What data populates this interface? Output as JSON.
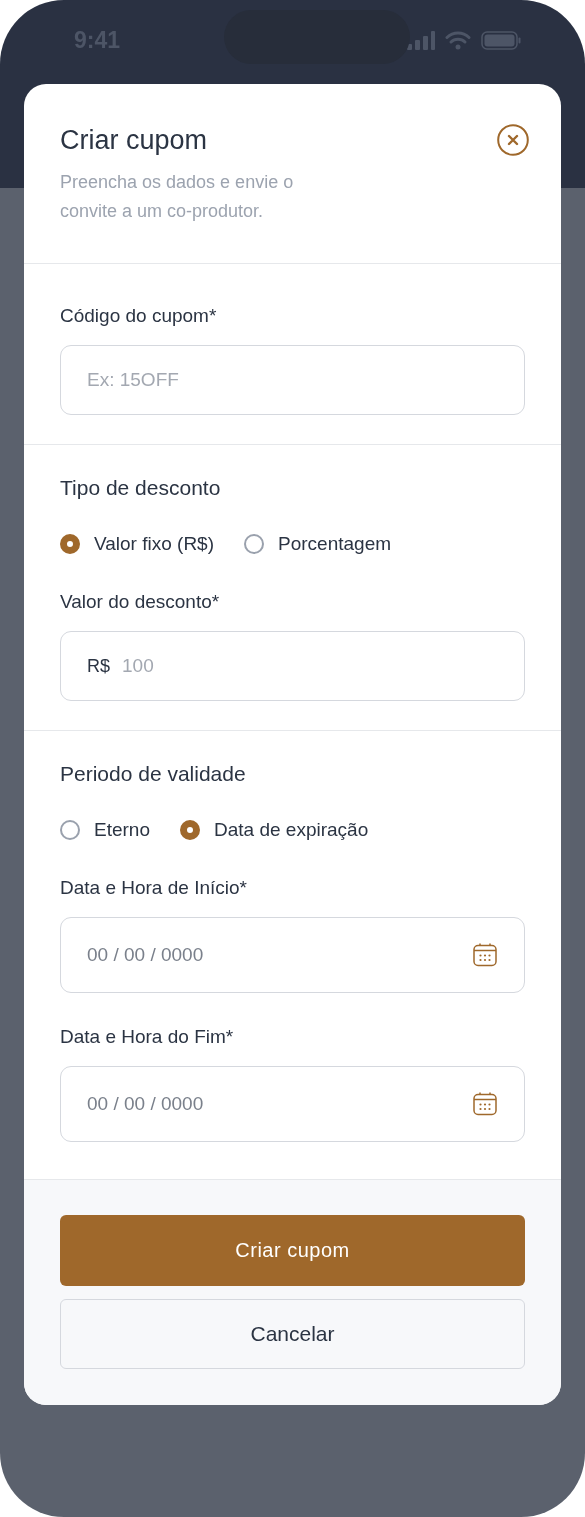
{
  "status_bar": {
    "time": "9:41"
  },
  "modal": {
    "title": "Criar cupom",
    "subtitle": "Preencha os dados e envie o convite a um co-produtor."
  },
  "sections": [
    {
      "fields": [
        {
          "kind": "text",
          "label": "Código do cupom*",
          "placeholder": "Ex: 15OFF"
        }
      ]
    },
    {
      "title": "Tipo de desconto",
      "options": [
        {
          "label": "Valor fixo (R$)",
          "selected": true
        },
        {
          "label": "Porcentagem",
          "selected": false
        }
      ],
      "fields": [
        {
          "kind": "currency",
          "label": "Valor do desconto*",
          "prefix": "R$",
          "placeholder": "100"
        }
      ]
    },
    {
      "title": "Periodo de validade",
      "options": [
        {
          "label": "Eterno",
          "selected": false
        },
        {
          "label": "Data de expiração",
          "selected": true
        }
      ],
      "fields": [
        {
          "kind": "date",
          "label": "Data e Hora de Início*",
          "placeholder": "00 / 00 / 0000"
        },
        {
          "kind": "date",
          "label": "Data e Hora do Fim*",
          "placeholder": "00 / 00 / 0000"
        }
      ]
    }
  ],
  "buttons": [
    {
      "kind": "primary",
      "label": "Criar cupom"
    },
    {
      "kind": "secondary",
      "label": "Cancelar"
    }
  ]
}
